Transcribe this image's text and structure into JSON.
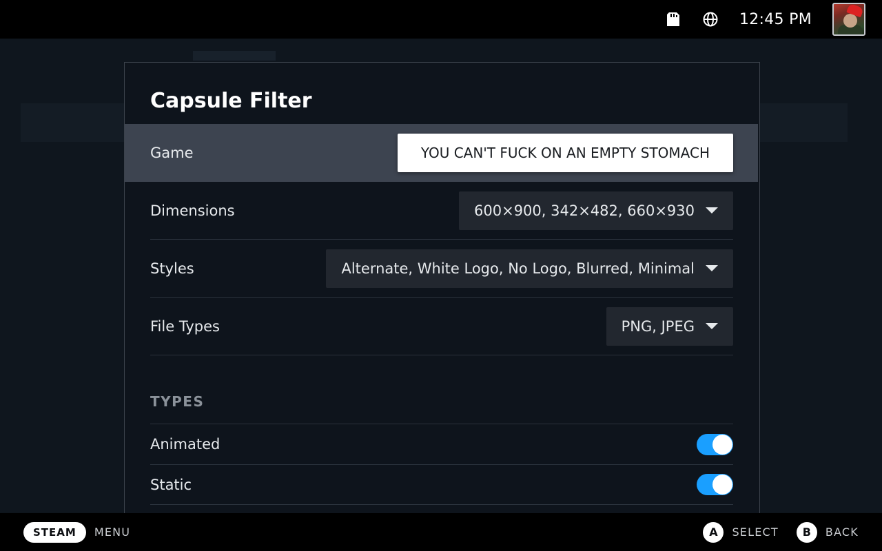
{
  "status_bar": {
    "icons": [
      "sd-card-icon",
      "globe-icon"
    ],
    "time": "12:45 PM"
  },
  "modal": {
    "title": "Capsule Filter",
    "rows": {
      "game": {
        "label": "Game",
        "value": "YOU CAN'T FUCK ON AN EMPTY STOMACH"
      },
      "dimensions": {
        "label": "Dimensions",
        "value": "600×900, 342×482, 660×930"
      },
      "styles": {
        "label": "Styles",
        "value": "Alternate, White Logo, No Logo, Blurred, Minimal"
      },
      "file_types": {
        "label": "File Types",
        "value": "PNG, JPEG"
      }
    },
    "types_section": {
      "heading": "TYPES",
      "toggles": [
        {
          "label": "Animated",
          "on": true
        },
        {
          "label": "Static",
          "on": true
        }
      ]
    }
  },
  "footer": {
    "steam_label": "STEAM",
    "menu_label": "MENU",
    "a_key": "A",
    "select_label": "SELECT",
    "b_key": "B",
    "back_label": "BACK"
  },
  "colors": {
    "accent": "#1a9fff",
    "focused_row": "#3d4450",
    "background": "#0e141c"
  }
}
